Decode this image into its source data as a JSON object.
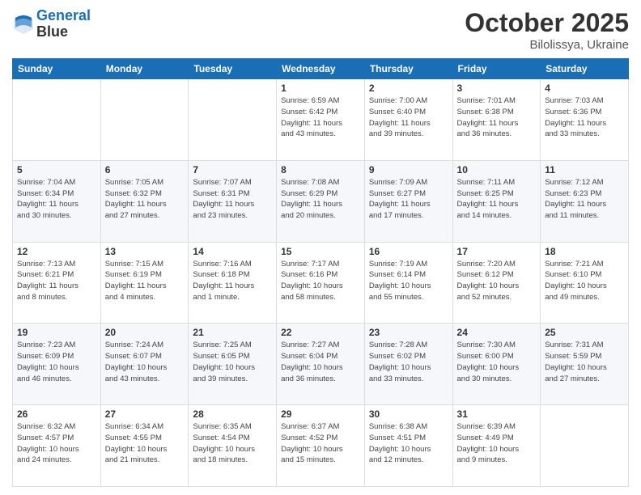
{
  "header": {
    "logo_line1": "General",
    "logo_line2": "Blue",
    "month_title": "October 2025",
    "subtitle": "Bilolissya, Ukraine"
  },
  "weekdays": [
    "Sunday",
    "Monday",
    "Tuesday",
    "Wednesday",
    "Thursday",
    "Friday",
    "Saturday"
  ],
  "weeks": [
    [
      {
        "day": "",
        "info": ""
      },
      {
        "day": "",
        "info": ""
      },
      {
        "day": "",
        "info": ""
      },
      {
        "day": "1",
        "info": "Sunrise: 6:59 AM\nSunset: 6:42 PM\nDaylight: 11 hours\nand 43 minutes."
      },
      {
        "day": "2",
        "info": "Sunrise: 7:00 AM\nSunset: 6:40 PM\nDaylight: 11 hours\nand 39 minutes."
      },
      {
        "day": "3",
        "info": "Sunrise: 7:01 AM\nSunset: 6:38 PM\nDaylight: 11 hours\nand 36 minutes."
      },
      {
        "day": "4",
        "info": "Sunrise: 7:03 AM\nSunset: 6:36 PM\nDaylight: 11 hours\nand 33 minutes."
      }
    ],
    [
      {
        "day": "5",
        "info": "Sunrise: 7:04 AM\nSunset: 6:34 PM\nDaylight: 11 hours\nand 30 minutes."
      },
      {
        "day": "6",
        "info": "Sunrise: 7:05 AM\nSunset: 6:32 PM\nDaylight: 11 hours\nand 27 minutes."
      },
      {
        "day": "7",
        "info": "Sunrise: 7:07 AM\nSunset: 6:31 PM\nDaylight: 11 hours\nand 23 minutes."
      },
      {
        "day": "8",
        "info": "Sunrise: 7:08 AM\nSunset: 6:29 PM\nDaylight: 11 hours\nand 20 minutes."
      },
      {
        "day": "9",
        "info": "Sunrise: 7:09 AM\nSunset: 6:27 PM\nDaylight: 11 hours\nand 17 minutes."
      },
      {
        "day": "10",
        "info": "Sunrise: 7:11 AM\nSunset: 6:25 PM\nDaylight: 11 hours\nand 14 minutes."
      },
      {
        "day": "11",
        "info": "Sunrise: 7:12 AM\nSunset: 6:23 PM\nDaylight: 11 hours\nand 11 minutes."
      }
    ],
    [
      {
        "day": "12",
        "info": "Sunrise: 7:13 AM\nSunset: 6:21 PM\nDaylight: 11 hours\nand 8 minutes."
      },
      {
        "day": "13",
        "info": "Sunrise: 7:15 AM\nSunset: 6:19 PM\nDaylight: 11 hours\nand 4 minutes."
      },
      {
        "day": "14",
        "info": "Sunrise: 7:16 AM\nSunset: 6:18 PM\nDaylight: 11 hours\nand 1 minute."
      },
      {
        "day": "15",
        "info": "Sunrise: 7:17 AM\nSunset: 6:16 PM\nDaylight: 10 hours\nand 58 minutes."
      },
      {
        "day": "16",
        "info": "Sunrise: 7:19 AM\nSunset: 6:14 PM\nDaylight: 10 hours\nand 55 minutes."
      },
      {
        "day": "17",
        "info": "Sunrise: 7:20 AM\nSunset: 6:12 PM\nDaylight: 10 hours\nand 52 minutes."
      },
      {
        "day": "18",
        "info": "Sunrise: 7:21 AM\nSunset: 6:10 PM\nDaylight: 10 hours\nand 49 minutes."
      }
    ],
    [
      {
        "day": "19",
        "info": "Sunrise: 7:23 AM\nSunset: 6:09 PM\nDaylight: 10 hours\nand 46 minutes."
      },
      {
        "day": "20",
        "info": "Sunrise: 7:24 AM\nSunset: 6:07 PM\nDaylight: 10 hours\nand 43 minutes."
      },
      {
        "day": "21",
        "info": "Sunrise: 7:25 AM\nSunset: 6:05 PM\nDaylight: 10 hours\nand 39 minutes."
      },
      {
        "day": "22",
        "info": "Sunrise: 7:27 AM\nSunset: 6:04 PM\nDaylight: 10 hours\nand 36 minutes."
      },
      {
        "day": "23",
        "info": "Sunrise: 7:28 AM\nSunset: 6:02 PM\nDaylight: 10 hours\nand 33 minutes."
      },
      {
        "day": "24",
        "info": "Sunrise: 7:30 AM\nSunset: 6:00 PM\nDaylight: 10 hours\nand 30 minutes."
      },
      {
        "day": "25",
        "info": "Sunrise: 7:31 AM\nSunset: 5:59 PM\nDaylight: 10 hours\nand 27 minutes."
      }
    ],
    [
      {
        "day": "26",
        "info": "Sunrise: 6:32 AM\nSunset: 4:57 PM\nDaylight: 10 hours\nand 24 minutes."
      },
      {
        "day": "27",
        "info": "Sunrise: 6:34 AM\nSunset: 4:55 PM\nDaylight: 10 hours\nand 21 minutes."
      },
      {
        "day": "28",
        "info": "Sunrise: 6:35 AM\nSunset: 4:54 PM\nDaylight: 10 hours\nand 18 minutes."
      },
      {
        "day": "29",
        "info": "Sunrise: 6:37 AM\nSunset: 4:52 PM\nDaylight: 10 hours\nand 15 minutes."
      },
      {
        "day": "30",
        "info": "Sunrise: 6:38 AM\nSunset: 4:51 PM\nDaylight: 10 hours\nand 12 minutes."
      },
      {
        "day": "31",
        "info": "Sunrise: 6:39 AM\nSunset: 4:49 PM\nDaylight: 10 hours\nand 9 minutes."
      },
      {
        "day": "",
        "info": ""
      }
    ]
  ]
}
